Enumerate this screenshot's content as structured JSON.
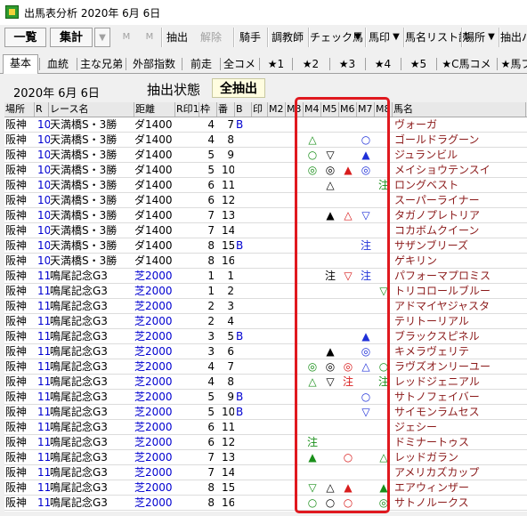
{
  "window": {
    "title": "出馬表分析 2020年 6月 6日"
  },
  "toolbar": {
    "ichiran": "一覧",
    "shukei": "集計",
    "m1": "M",
    "m2": "M",
    "chushutsu": "抽出",
    "kaijo": "解除",
    "kishu": "騎手",
    "chokyoshi": "調教師",
    "check_uma": "チェック馬",
    "umajirushi": "馬印",
    "list": "馬名リスト読",
    "basho": "場所",
    "chushutsu_cut": "抽出バ",
    "dropdown_arrow": "▼"
  },
  "tabs": [
    "基本",
    "血統",
    "主な兄弟",
    "外部指数",
    "前走",
    "全コメ",
    "★1",
    "★2",
    "★3",
    "★4",
    "★5",
    "★C馬コメ",
    "★馬ブ"
  ],
  "header_info": {
    "date": "2020年  6月  6日",
    "status_label": "抽出状態",
    "status_value": "全抽出"
  },
  "columns": [
    "場所",
    "R",
    "レース名",
    "距離",
    "R印1",
    "枠",
    "番",
    "B",
    "印",
    "M2",
    "M3",
    "M4",
    "M5",
    "M6",
    "M7",
    "M8",
    "馬名"
  ],
  "rows": [
    {
      "place": "阪神",
      "r": "10",
      "race": "天満橋S・3勝",
      "dist": "ダ1400",
      "waku": "4",
      "ban": "7",
      "b": "B",
      "m4": "",
      "m5": "",
      "m6": "",
      "m7": "",
      "m8": "",
      "name": "ヴォーガ"
    },
    {
      "place": "阪神",
      "r": "10",
      "race": "天満橋S・3勝",
      "dist": "ダ1400",
      "waku": "4",
      "ban": "8",
      "b": "",
      "m4": "△",
      "m5": "",
      "m6": "",
      "m7": "○",
      "m8": "",
      "name": "ゴールドラグーン"
    },
    {
      "place": "阪神",
      "r": "10",
      "race": "天満橋S・3勝",
      "dist": "ダ1400",
      "waku": "5",
      "ban": "9",
      "b": "",
      "m4": "○",
      "m5": "▽",
      "m6": "",
      "m7": "▲",
      "m8": "",
      "name": "ジュランビル"
    },
    {
      "place": "阪神",
      "r": "10",
      "race": "天満橋S・3勝",
      "dist": "ダ1400",
      "waku": "5",
      "ban": "10",
      "b": "",
      "m4": "◎",
      "m5": "◎",
      "m6": "▲",
      "m7": "◎",
      "m8": "",
      "name": "メイショウテンスイ"
    },
    {
      "place": "阪神",
      "r": "10",
      "race": "天満橋S・3勝",
      "dist": "ダ1400",
      "waku": "6",
      "ban": "11",
      "b": "",
      "m4": "",
      "m5": "△",
      "m6": "",
      "m7": "",
      "m8": "注",
      "name": "ロングベスト"
    },
    {
      "place": "阪神",
      "r": "10",
      "race": "天満橋S・3勝",
      "dist": "ダ1400",
      "waku": "6",
      "ban": "12",
      "b": "",
      "m4": "",
      "m5": "",
      "m6": "",
      "m7": "",
      "m8": "",
      "name": "スーパーライナー"
    },
    {
      "place": "阪神",
      "r": "10",
      "race": "天満橋S・3勝",
      "dist": "ダ1400",
      "waku": "7",
      "ban": "13",
      "b": "",
      "m4": "",
      "m5": "▲",
      "m6": "△",
      "m7": "▽",
      "m8": "",
      "name": "タガノプレトリア"
    },
    {
      "place": "阪神",
      "r": "10",
      "race": "天満橋S・3勝",
      "dist": "ダ1400",
      "waku": "7",
      "ban": "14",
      "b": "",
      "m4": "",
      "m5": "",
      "m6": "",
      "m7": "",
      "m8": "",
      "name": "コカボムクイーン"
    },
    {
      "place": "阪神",
      "r": "10",
      "race": "天満橋S・3勝",
      "dist": "ダ1400",
      "waku": "8",
      "ban": "15",
      "b": "B",
      "m4": "",
      "m5": "",
      "m6": "",
      "m7": "注",
      "m8": "",
      "name": "サザンブリーズ"
    },
    {
      "place": "阪神",
      "r": "10",
      "race": "天満橋S・3勝",
      "dist": "ダ1400",
      "waku": "8",
      "ban": "16",
      "b": "",
      "m4": "",
      "m5": "",
      "m6": "",
      "m7": "",
      "m8": "",
      "name": "ゲキリン"
    },
    {
      "place": "阪神",
      "r": "11",
      "race": "鳴尾記念G3",
      "dist": "芝2000",
      "waku": "1",
      "ban": "1",
      "b": "",
      "m4": "",
      "m5": "注",
      "m6": "▽",
      "m7": "注",
      "m8": "",
      "name": "パフォーマプロミス"
    },
    {
      "place": "阪神",
      "r": "11",
      "race": "鳴尾記念G3",
      "dist": "芝2000",
      "waku": "1",
      "ban": "2",
      "b": "",
      "m4": "",
      "m5": "",
      "m6": "",
      "m7": "",
      "m8": "▽",
      "name": "トリコロールブルー"
    },
    {
      "place": "阪神",
      "r": "11",
      "race": "鳴尾記念G3",
      "dist": "芝2000",
      "waku": "2",
      "ban": "3",
      "b": "",
      "m4": "",
      "m5": "",
      "m6": "",
      "m7": "",
      "m8": "",
      "name": "アドマイヤジャスタ"
    },
    {
      "place": "阪神",
      "r": "11",
      "race": "鳴尾記念G3",
      "dist": "芝2000",
      "waku": "2",
      "ban": "4",
      "b": "",
      "m4": "",
      "m5": "",
      "m6": "",
      "m7": "",
      "m8": "",
      "name": "テリトーリアル"
    },
    {
      "place": "阪神",
      "r": "11",
      "race": "鳴尾記念G3",
      "dist": "芝2000",
      "waku": "3",
      "ban": "5",
      "b": "B",
      "m4": "",
      "m5": "",
      "m6": "",
      "m7": "▲",
      "m8": "",
      "name": "ブラックスピネル"
    },
    {
      "place": "阪神",
      "r": "11",
      "race": "鳴尾記念G3",
      "dist": "芝2000",
      "waku": "3",
      "ban": "6",
      "b": "",
      "m4": "",
      "m5": "▲",
      "m6": "",
      "m7": "◎",
      "m8": "",
      "name": "キメラヴェリテ"
    },
    {
      "place": "阪神",
      "r": "11",
      "race": "鳴尾記念G3",
      "dist": "芝2000",
      "waku": "4",
      "ban": "7",
      "b": "",
      "m4": "◎",
      "m5": "◎",
      "m6": "◎",
      "m7": "△",
      "m8": "○",
      "name": "ラヴズオンリーユー"
    },
    {
      "place": "阪神",
      "r": "11",
      "race": "鳴尾記念G3",
      "dist": "芝2000",
      "waku": "4",
      "ban": "8",
      "b": "",
      "m4": "△",
      "m5": "▽",
      "m6": "注",
      "m7": "",
      "m8": "注",
      "name": "レッドジェニアル"
    },
    {
      "place": "阪神",
      "r": "11",
      "race": "鳴尾記念G3",
      "dist": "芝2000",
      "waku": "5",
      "ban": "9",
      "b": "B",
      "m4": "",
      "m5": "",
      "m6": "",
      "m7": "○",
      "m8": "",
      "name": "サトノフェイバー"
    },
    {
      "place": "阪神",
      "r": "11",
      "race": "鳴尾記念G3",
      "dist": "芝2000",
      "waku": "5",
      "ban": "10",
      "b": "B",
      "m4": "",
      "m5": "",
      "m6": "",
      "m7": "▽",
      "m8": "",
      "name": "サイモンラムセス"
    },
    {
      "place": "阪神",
      "r": "11",
      "race": "鳴尾記念G3",
      "dist": "芝2000",
      "waku": "6",
      "ban": "11",
      "b": "",
      "m4": "",
      "m5": "",
      "m6": "",
      "m7": "",
      "m8": "",
      "name": "ジェシー"
    },
    {
      "place": "阪神",
      "r": "11",
      "race": "鳴尾記念G3",
      "dist": "芝2000",
      "waku": "6",
      "ban": "12",
      "b": "",
      "m4": "注",
      "m5": "",
      "m6": "",
      "m7": "",
      "m8": "",
      "name": "ドミナートゥス"
    },
    {
      "place": "阪神",
      "r": "11",
      "race": "鳴尾記念G3",
      "dist": "芝2000",
      "waku": "7",
      "ban": "13",
      "b": "",
      "m4": "▲",
      "m5": "",
      "m6": "○",
      "m7": "",
      "m8": "△",
      "name": "レッドガラン"
    },
    {
      "place": "阪神",
      "r": "11",
      "race": "鳴尾記念G3",
      "dist": "芝2000",
      "waku": "7",
      "ban": "14",
      "b": "",
      "m4": "",
      "m5": "",
      "m6": "",
      "m7": "",
      "m8": "",
      "name": "アメリカズカップ"
    },
    {
      "place": "阪神",
      "r": "11",
      "race": "鳴尾記念G3",
      "dist": "芝2000",
      "waku": "8",
      "ban": "15",
      "b": "",
      "m4": "▽",
      "m5": "△",
      "m6": "▲",
      "m7": "",
      "m8": "▲",
      "name": "エアウィンザー"
    },
    {
      "place": "阪神",
      "r": "11",
      "race": "鳴尾記念G3",
      "dist": "芝2000",
      "waku": "8",
      "ban": "16",
      "b": "",
      "m4": "○",
      "m5": "○",
      "m6": "○",
      "m7": "",
      "m8": "◎",
      "name": "サトノルークス"
    }
  ],
  "symbol_colors": {
    "◎": "#1a8f1a",
    "○": "#1a8f1a",
    "▲": "#1a8f1a",
    "△": "#1a8f1a",
    "▽": "#1a8f1a",
    "注": "#1a8f1a"
  },
  "highlight_color": "#e0191f"
}
